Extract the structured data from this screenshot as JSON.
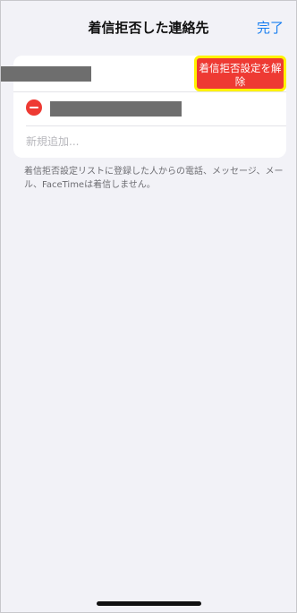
{
  "nav": {
    "title": "着信拒否した連絡先",
    "done_label": "完了"
  },
  "list": {
    "unblock_button_label": "着信拒否設定を解除",
    "add_new_placeholder": "新規追加..."
  },
  "footer": {
    "note": "着信拒否設定リストに登録した人からの電話、メッセージ、メール、FaceTimeは着信しません。"
  },
  "colors": {
    "accent": "#1a7ff0",
    "destructive": "#ee3a33",
    "highlight": "#fff200"
  }
}
